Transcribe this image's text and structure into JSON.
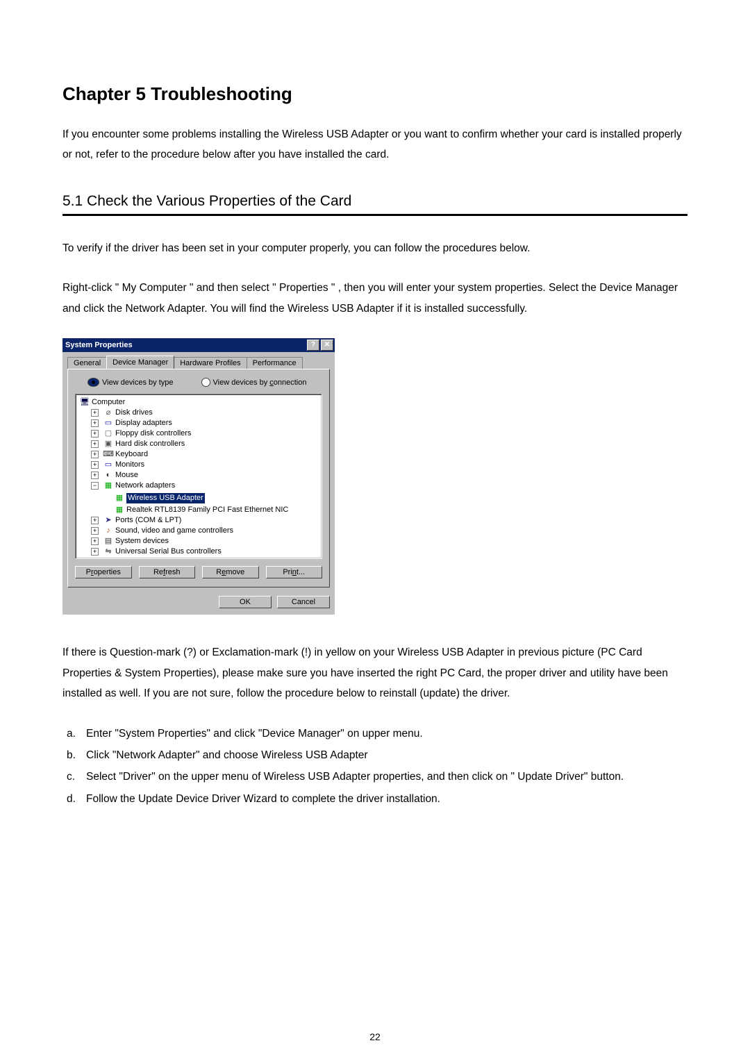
{
  "chapter_title": "Chapter 5    Troubleshooting",
  "intro_para": "If you encounter some problems installing the Wireless USB Adapter or you want to confirm whether your card is installed properly or not, refer to the procedure below after you have installed the card.",
  "section_title": "5.1   Check the Various Properties of the Card",
  "para1": "To verify if the driver has been set in your computer properly, you can follow the procedures below.",
  "para2": "Right-click \" My Computer \" and then select \" Properties \" , then you will enter your system properties. Select the Device Manager and click the Network Adapter. You will find the Wireless USB Adapter if it is installed successfully.",
  "window": {
    "title": "System Properties",
    "help_glyph": "?",
    "close_glyph": "✕",
    "tabs": {
      "general": "General",
      "device_manager": "Device Manager",
      "hardware_profiles": "Hardware Profiles",
      "performance": "Performance"
    },
    "radio_by_type": "View devices by type",
    "radio_by_conn_pre": "View devices by ",
    "radio_by_conn_und": "c",
    "radio_by_conn_post": "onnection",
    "tree": {
      "root": "Computer",
      "items": {
        "disk": "Disk drives",
        "display": "Display adapters",
        "floppy": "Floppy disk controllers",
        "hdd": "Hard disk controllers",
        "kbd": "Keyboard",
        "mon": "Monitors",
        "mouse": "Mouse",
        "net": "Network adapters",
        "net_children": {
          "wusb": "Wireless USB Adapter",
          "realtek": "Realtek RTL8139 Family PCI Fast Ethernet NIC"
        },
        "ports": "Ports (COM & LPT)",
        "sound": "Sound, video and game controllers",
        "sys": "System devices",
        "usb": "Universal Serial Bus controllers"
      }
    },
    "buttons": {
      "properties_pre": "P",
      "properties_und": "r",
      "properties_post": "operties",
      "refresh_pre": "Re",
      "refresh_und": "f",
      "refresh_post": "resh",
      "remove_pre": "R",
      "remove_und": "e",
      "remove_post": "move",
      "print_pre": "Pri",
      "print_und": "n",
      "print_post": "t..."
    },
    "ok": "OK",
    "cancel": "Cancel"
  },
  "para3": "If there is Question-mark (?) or Exclamation-mark (!) in yellow on your Wireless USB Adapter in previous picture (PC Card Properties & System Properties), please make sure you have inserted the right PC Card, the proper driver and utility have been installed as well. If you are not sure, follow the procedure below to reinstall (update) the driver.",
  "steps": {
    "a": {
      "letter": "a.",
      "text": "Enter \"System Properties\" and click \"Device Manager\" on upper menu."
    },
    "b": {
      "letter": "b.",
      "text": "Click \"Network Adapter\" and choose Wireless USB Adapter"
    },
    "c": {
      "letter": "c.",
      "text": "Select \"Driver\" on the upper menu of Wireless USB Adapter properties, and then click on \" Update Driver\" button."
    },
    "d": {
      "letter": "d.",
      "text": "Follow the Update Device Driver Wizard to complete the driver installation."
    }
  },
  "page_number": "22",
  "glyphs": {
    "plus": "+",
    "minus": "−",
    "computer": "🖥",
    "disk": "⌀",
    "display": "▭",
    "floppy": "▢",
    "hdd": "▣",
    "kbd": "⌨",
    "mon": "▭",
    "mouse": "◐",
    "net": "▦",
    "port": "➤",
    "sound": "♪",
    "sys": "▤",
    "usb": "⇋"
  }
}
